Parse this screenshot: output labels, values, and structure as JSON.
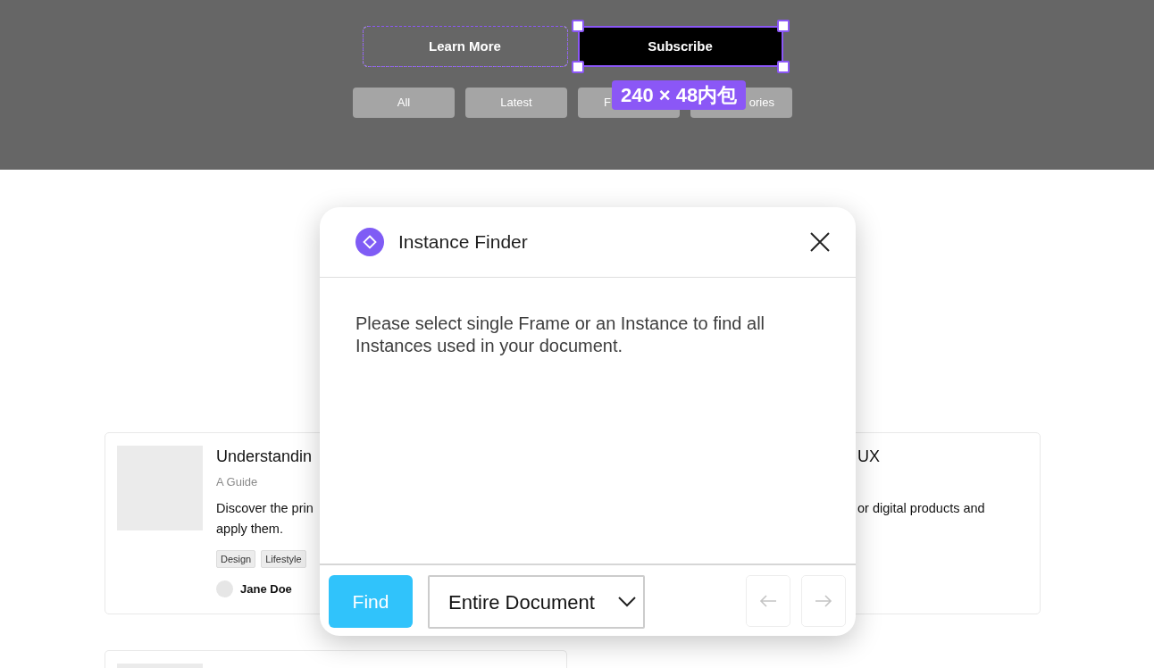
{
  "hero": {
    "buttons": [
      {
        "label": "Learn More",
        "kind": "outline",
        "hovered": true,
        "selected": false
      },
      {
        "label": "Subscribe",
        "kind": "solid",
        "hovered": false,
        "selected": true
      }
    ],
    "size_badge": "240 × 48内包",
    "filters": [
      "All",
      "Latest",
      "F",
      "ories"
    ]
  },
  "cards": [
    {
      "image": true,
      "title": "Understandin",
      "subtitle": "A Guide",
      "description": "Discover the prin\napply them.",
      "tags": [
        "Design",
        "Lifestyle"
      ],
      "author": "Jane Doe"
    },
    {
      "image": false,
      "title": "UX",
      "description": "or digital products and"
    },
    {
      "image": true
    }
  ],
  "dialog": {
    "title": "Instance Finder",
    "message": "Please select single Frame or an Instance to find all Instances used in your document.",
    "find_button": "Find",
    "scope": "Entire Document",
    "nav_buttons": [
      {
        "kind": "previous",
        "disabled": true
      },
      {
        "kind": "next",
        "disabled": true
      }
    ]
  }
}
